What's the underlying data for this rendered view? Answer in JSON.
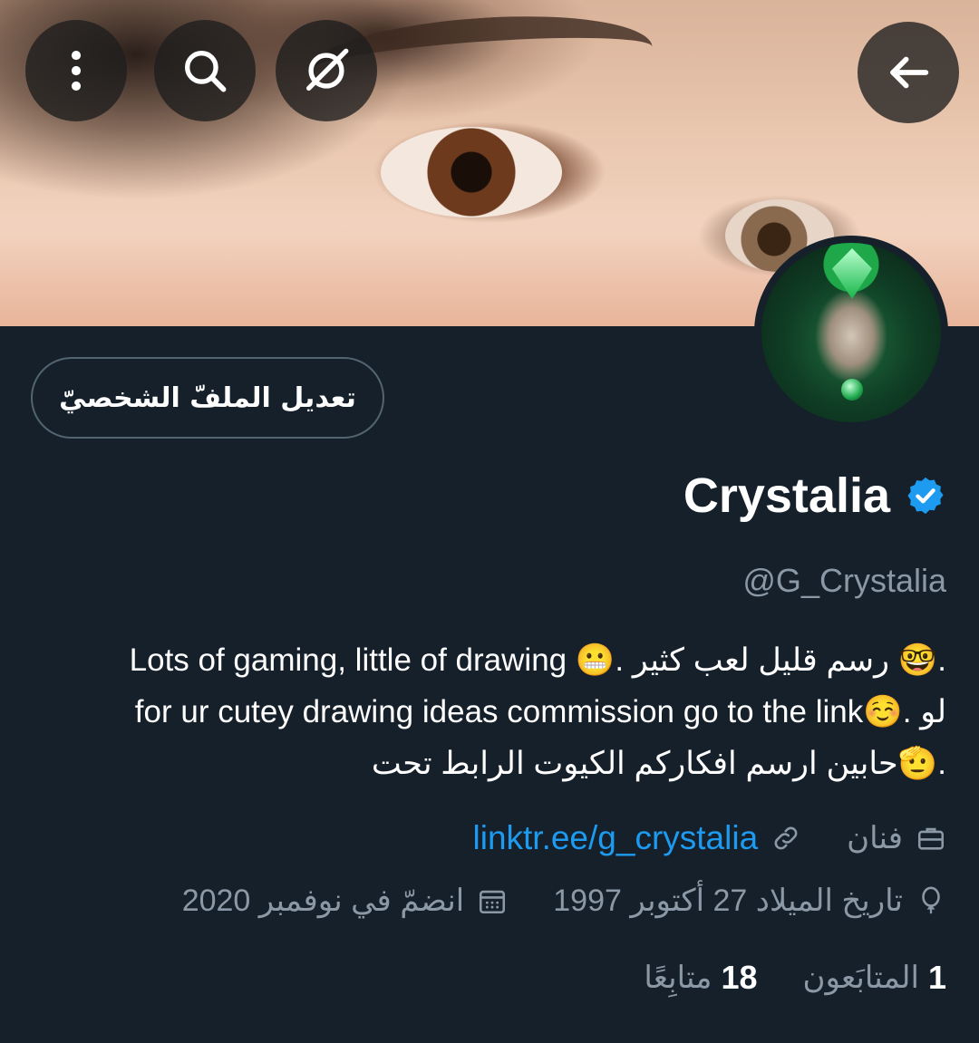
{
  "profile": {
    "display_name": "Crystalia",
    "handle": "@G_Crystalia",
    "edit_button_label": "تعديل الملفّ الشخصيّ",
    "bio_lines": [
      ".🤓 رسم قليل لعب كثير .😬 Lots of gaming, little of drawing",
      "لو .☺️for ur cutey drawing ideas commission go to the link",
      ".🫡حابين ارسم افكاركم الكيوت الرابط تحت"
    ],
    "profession": "فنان",
    "link": "linktr.ee/g_crystalia",
    "birthdate": "تاريخ الميلاد 27 أكتوبر 1997",
    "joined": "انضمّ في نوفمبر 2020",
    "followers_count": "1",
    "followers_label": "المتابَعون",
    "following_count": "18",
    "following_label": "متابِعًا"
  },
  "colors": {
    "background": "#15202b",
    "accent": "#1d9bf0",
    "muted": "#8b98a5"
  },
  "icons": {
    "back": "arrow-left-icon",
    "grok": "grok-icon",
    "search": "search-icon",
    "more": "more-vertical-icon",
    "verified": "verified-badge-icon",
    "briefcase": "briefcase-icon",
    "link": "link-icon",
    "location": "balloon-icon",
    "calendar": "calendar-icon"
  }
}
